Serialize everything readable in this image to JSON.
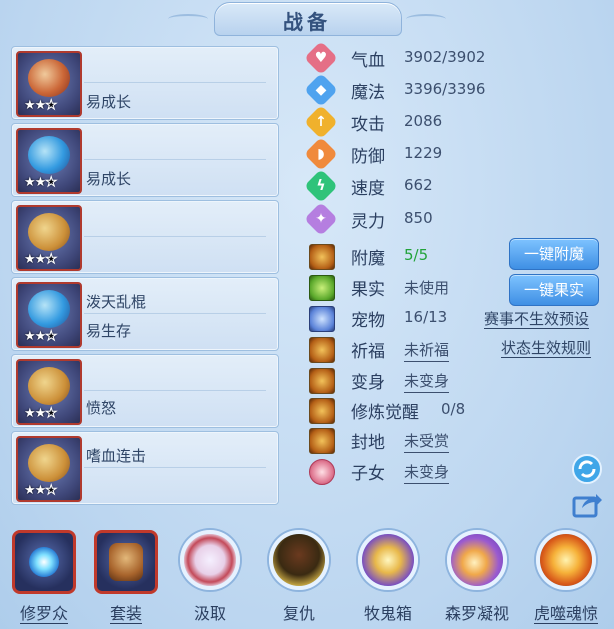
{
  "title": "战备",
  "equipment": [
    {
      "stars_filled": 2,
      "stars_total": 3,
      "name": "",
      "effect": "易成长"
    },
    {
      "stars_filled": 2,
      "stars_total": 3,
      "name": "",
      "effect": "易成长"
    },
    {
      "stars_filled": 2,
      "stars_total": 3,
      "name": "",
      "effect": ""
    },
    {
      "stars_filled": 2,
      "stars_total": 3,
      "name": "泼天乱棍",
      "effect": "易生存"
    },
    {
      "stars_filled": 2,
      "stars_total": 3,
      "name": "",
      "effect": "愤怒"
    },
    {
      "stars_filled": 2,
      "stars_total": 3,
      "name": "嗜血连击",
      "effect": ""
    }
  ],
  "stars_text": {
    "filled": "★",
    "empty": "☆"
  },
  "stats": [
    {
      "name": "气血",
      "value": "3902/3902",
      "icon": "heart-icon",
      "color": "#e56f86"
    },
    {
      "name": "魔法",
      "value": "3396/3396",
      "icon": "mana-icon",
      "color": "#4fa3ef"
    },
    {
      "name": "攻击",
      "value": "2086",
      "icon": "attack-icon",
      "color": "#f0b12c"
    },
    {
      "name": "防御",
      "value": "1229",
      "icon": "defense-icon",
      "color": "#f08a3c"
    },
    {
      "name": "速度",
      "value": "662",
      "icon": "speed-icon",
      "color": "#2fc37a"
    },
    {
      "name": "灵力",
      "value": "850",
      "icon": "spirit-icon",
      "color": "#b57ee0"
    }
  ],
  "rows": [
    {
      "name": "附魔",
      "value": "5/5",
      "icon": "enchant-icon"
    },
    {
      "name": "果实",
      "value": "未使用",
      "icon": "fruit-icon"
    },
    {
      "name": "宠物",
      "value": "16/13",
      "icon": "pet-icon"
    },
    {
      "name": "祈福",
      "value": "未祈福",
      "icon": "blessing-icon"
    },
    {
      "name": "变身",
      "value": "未变身",
      "icon": "transform-icon"
    },
    {
      "name": "修炼觉醒",
      "value": "0/8",
      "icon": "cultivation-icon"
    },
    {
      "name": "封地",
      "value": "未受赏",
      "icon": "fief-icon"
    },
    {
      "name": "子女",
      "value": "未变身",
      "icon": "children-icon"
    }
  ],
  "buttons": {
    "enchant": "一键附魔",
    "fruit": "一键果实",
    "preset": "赛事不生效预设",
    "rules": "状态生效规则"
  },
  "bottom_bar": [
    {
      "label": "修罗众",
      "icon": "shura-icon"
    },
    {
      "label": "套装",
      "icon": "suit-icon"
    },
    {
      "label": "汲取",
      "icon": "absorb-icon"
    },
    {
      "label": "复仇",
      "icon": "revenge-icon"
    },
    {
      "label": "牧鬼箱",
      "icon": "ghost-box-icon"
    },
    {
      "label": "森罗凝视",
      "icon": "gaze-icon"
    },
    {
      "label": "虎噬魂惊",
      "icon": "tiger-soul-icon"
    }
  ]
}
